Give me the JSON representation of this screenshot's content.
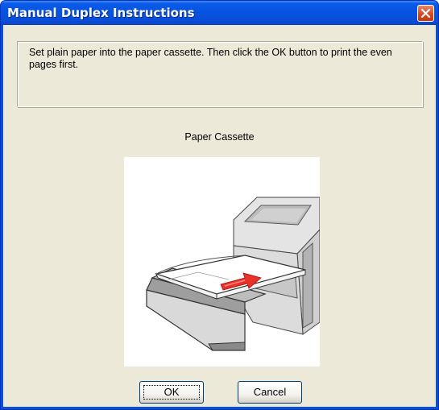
{
  "window": {
    "title": "Manual Duplex Instructions",
    "close_icon": "close-icon"
  },
  "message": {
    "text": "Set plain paper into the paper cassette. Then click the OK button to print the even pages first."
  },
  "illustration": {
    "label": "Paper Cassette",
    "icon": "paper-cassette-illustration"
  },
  "buttons": {
    "ok_label": "OK",
    "cancel_label": "Cancel"
  },
  "colors": {
    "titlebar": "#0a5ae8",
    "dialog_bg": "#ece9d8",
    "close_button": "#d54a22",
    "arrow": "#e8322a"
  }
}
